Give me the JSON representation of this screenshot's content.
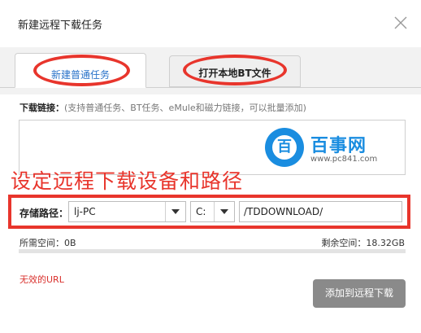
{
  "dialog": {
    "title": "新建远程下载任务"
  },
  "tabs": [
    {
      "label": "新建普通任务",
      "active": true
    },
    {
      "label": "打开本地BT文件",
      "active": false
    }
  ],
  "link": {
    "label": "下载链接：",
    "hint": "(支持普通任务、BT任务、eMule和磁力链接，可以批量添加)",
    "value": ""
  },
  "watermark": {
    "glyph": "百",
    "brand": "百事网",
    "url": "www.pc841.com"
  },
  "annotation": "设定远程下载设备和路径",
  "path": {
    "label": "存储路径：",
    "device": "lj-PC",
    "drive": "C:",
    "folder": "/TDDOWNLOAD/"
  },
  "space": {
    "required": "所需空间：0B",
    "remaining": "剩余空间：18.32GB"
  },
  "error": "无效的URL",
  "submit_label": "添加到远程下载",
  "colors": {
    "accent": "#2a73c9",
    "annotation_red": "#e8352c",
    "error_red": "#d9302c",
    "button_gray": "#8a8a8a",
    "watermark_blue": "#1a8de0"
  },
  "icons": {
    "close": "close-icon",
    "dropdown": "chevron-down-icon",
    "watermark_logo": "baishi-logo-icon"
  }
}
